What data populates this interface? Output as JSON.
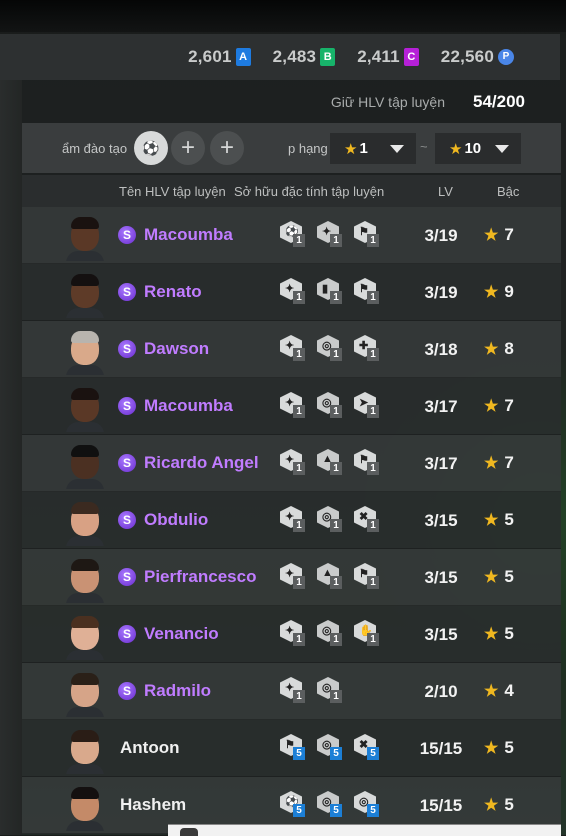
{
  "currencies": [
    {
      "amount": "2,601",
      "icon_text": "A",
      "icon_name": "currency-a-icon",
      "color": "#1e7be0",
      "round": false
    },
    {
      "amount": "2,483",
      "icon_text": "B",
      "icon_name": "currency-b-icon",
      "color": "#17b36a",
      "round": false
    },
    {
      "amount": "2,411",
      "icon_text": "C",
      "icon_name": "currency-c-icon",
      "color": "#b620d8",
      "round": false
    },
    {
      "amount": "22,560",
      "icon_text": "P",
      "icon_name": "currency-p-icon",
      "color": "#4a86e8",
      "round": true
    }
  ],
  "coach_count": {
    "label": "Giữ HLV tập luyện",
    "value": "54/200"
  },
  "filters": {
    "training_label": "ẩm đào tạo",
    "rank_label": "p hạng",
    "rank_from": "1",
    "rank_to": "10",
    "tilde": "~",
    "add_symbol": "+"
  },
  "columns": {
    "name": "Tên HLV tập luyện",
    "traits": "Sở hữu đặc tính tập luyện",
    "level": "LV",
    "rank": "Bậc"
  },
  "rows": [
    {
      "name": "Macoumba",
      "special": true,
      "lv": "3/19",
      "rank": "7",
      "skin": "#5a3826",
      "hair": "#1a1210",
      "traits": [
        {
          "glyph": "⚽",
          "lv": "1"
        },
        {
          "glyph": "✦",
          "lv": "1"
        },
        {
          "glyph": "⚑",
          "lv": "1"
        }
      ]
    },
    {
      "name": "Renato",
      "special": true,
      "lv": "3/19",
      "rank": "9",
      "skin": "#5e3b28",
      "hair": "#141010",
      "traits": [
        {
          "glyph": "✦",
          "lv": "1"
        },
        {
          "glyph": "▮",
          "lv": "1"
        },
        {
          "glyph": "⚑",
          "lv": "1"
        }
      ]
    },
    {
      "name": "Dawson",
      "special": true,
      "lv": "3/18",
      "rank": "8",
      "skin": "#d9a98a",
      "hair": "#b8b4ae",
      "traits": [
        {
          "glyph": "✦",
          "lv": "1"
        },
        {
          "glyph": "◎",
          "lv": "1"
        },
        {
          "glyph": "✚",
          "lv": "1"
        }
      ]
    },
    {
      "name": "Macoumba",
      "special": true,
      "lv": "3/17",
      "rank": "7",
      "skin": "#5a3826",
      "hair": "#1a1210",
      "traits": [
        {
          "glyph": "✦",
          "lv": "1"
        },
        {
          "glyph": "◎",
          "lv": "1"
        },
        {
          "glyph": "➤",
          "lv": "1"
        }
      ]
    },
    {
      "name": "Ricardo Angel",
      "special": true,
      "lv": "3/17",
      "rank": "7",
      "skin": "#4b3022",
      "hair": "#101010",
      "traits": [
        {
          "glyph": "✦",
          "lv": "1"
        },
        {
          "glyph": "▲",
          "lv": "1"
        },
        {
          "glyph": "⚑",
          "lv": "1"
        }
      ]
    },
    {
      "name": "Obdulio",
      "special": true,
      "lv": "3/15",
      "rank": "5",
      "skin": "#d8a184",
      "hair": "#3b2a20",
      "traits": [
        {
          "glyph": "✦",
          "lv": "1"
        },
        {
          "glyph": "◎",
          "lv": "1"
        },
        {
          "glyph": "✖",
          "lv": "1"
        }
      ]
    },
    {
      "name": "Pierfrancesco",
      "special": true,
      "lv": "3/15",
      "rank": "5",
      "skin": "#c99274",
      "hair": "#1e1814",
      "traits": [
        {
          "glyph": "✦",
          "lv": "1"
        },
        {
          "glyph": "▲",
          "lv": "1"
        },
        {
          "glyph": "⚑",
          "lv": "1"
        }
      ]
    },
    {
      "name": "Venancio",
      "special": true,
      "lv": "3/15",
      "rank": "5",
      "skin": "#dfb096",
      "hair": "#4a3020",
      "traits": [
        {
          "glyph": "✦",
          "lv": "1"
        },
        {
          "glyph": "◎",
          "lv": "1"
        },
        {
          "glyph": "✋",
          "lv": "1"
        }
      ]
    },
    {
      "name": "Radmilo",
      "special": true,
      "lv": "2/10",
      "rank": "4",
      "skin": "#d6a488",
      "hair": "#2a2018",
      "traits": [
        {
          "glyph": "✦",
          "lv": "1"
        },
        {
          "glyph": "◎",
          "lv": "1"
        }
      ]
    },
    {
      "name": "Antoon",
      "special": false,
      "lv": "15/15",
      "rank": "5",
      "skin": "#d9a98c",
      "hair": "#2a1d16",
      "traits": [
        {
          "glyph": "⚑",
          "lv": "5"
        },
        {
          "glyph": "◎",
          "lv": "5"
        },
        {
          "glyph": "✖",
          "lv": "5"
        }
      ]
    },
    {
      "name": "Hashem",
      "special": false,
      "lv": "15/15",
      "rank": "5",
      "skin": "#c48a68",
      "hair": "#141010",
      "traits": [
        {
          "glyph": "⚽",
          "lv": "5"
        },
        {
          "glyph": "◎",
          "lv": "5"
        },
        {
          "glyph": "◎",
          "lv": "5"
        }
      ]
    }
  ],
  "special_badge": "S",
  "star_symbol": "★"
}
